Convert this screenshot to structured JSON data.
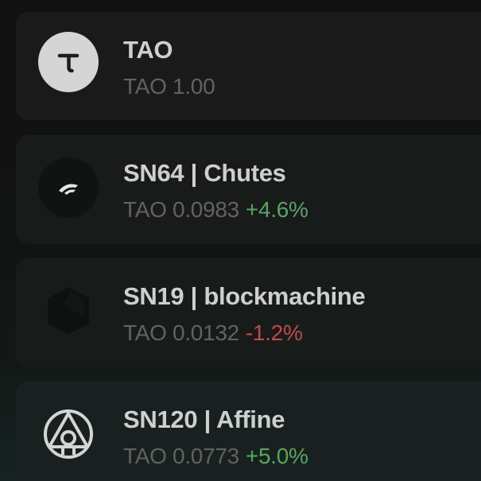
{
  "assets": [
    {
      "name": "TAO",
      "price_label": "TAO 1.00",
      "change": "",
      "change_direction": "none",
      "icon": "tao-logo-icon"
    },
    {
      "name": "SN64 | Chutes",
      "price_label": "TAO 0.0983",
      "change": "+4.6%",
      "change_direction": "up",
      "icon": "chutes-logo-icon"
    },
    {
      "name": "SN19 | blockmachine",
      "price_label": "TAO 0.0132",
      "change": "-1.2%",
      "change_direction": "down",
      "icon": "blockmachine-logo-icon"
    },
    {
      "name": "SN120 | Affine",
      "price_label": "TAO 0.0773",
      "change": "+5.0%",
      "change_direction": "up",
      "icon": "affine-logo-icon"
    }
  ],
  "colors": {
    "positive": "#55a85f",
    "negative": "#c04a4a",
    "muted_text": "#626262",
    "title_text": "#cfcfcf"
  }
}
